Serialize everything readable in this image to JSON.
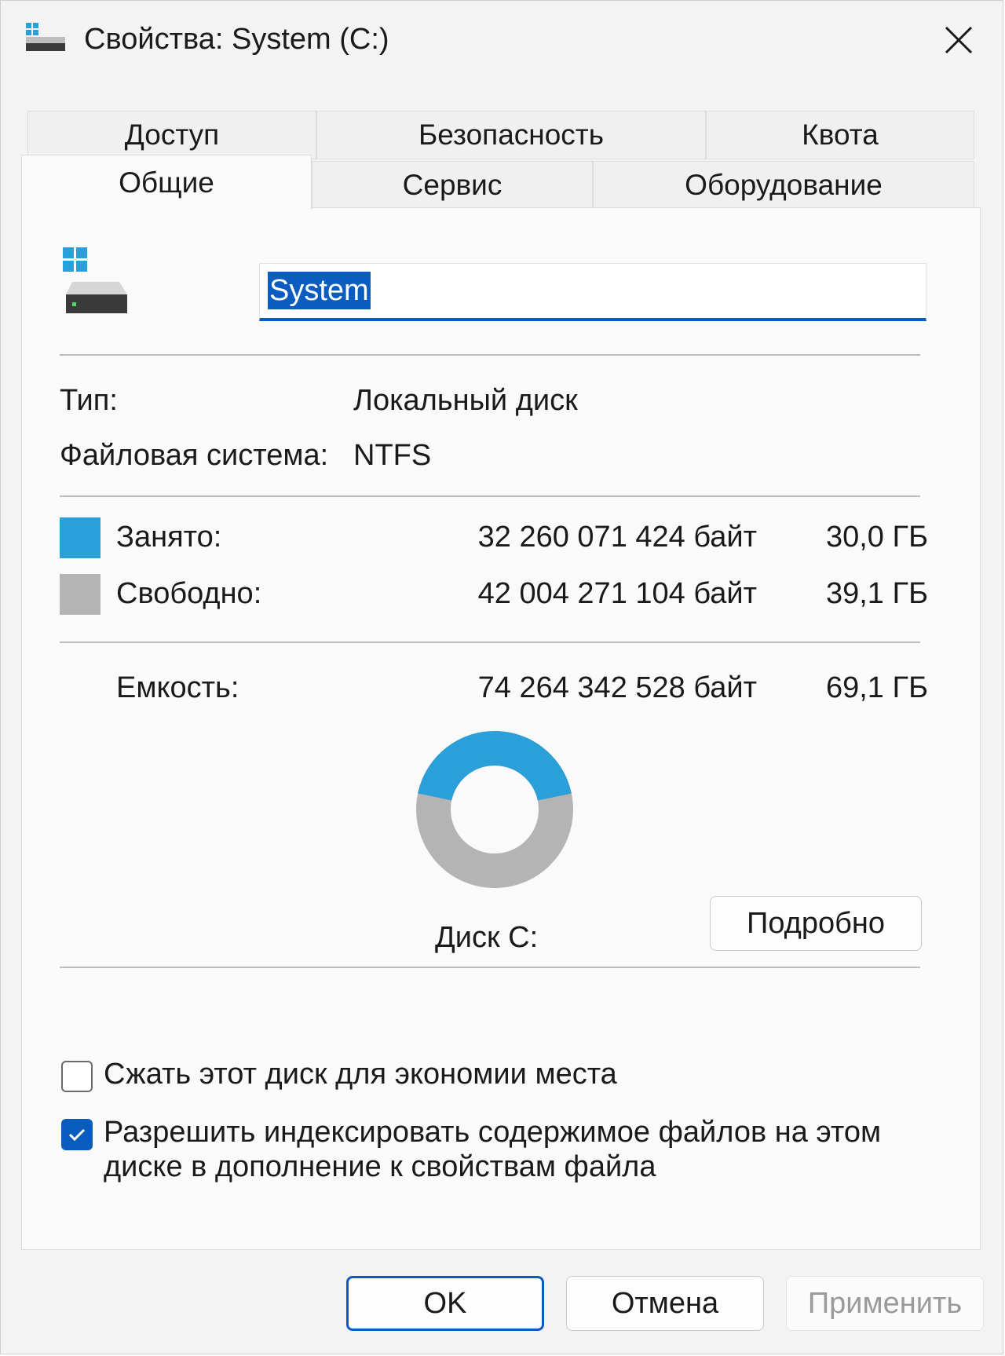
{
  "window": {
    "title": "Свойства: System (C:)"
  },
  "tabs": {
    "row1": [
      "Доступ",
      "Безопасность",
      "Квота"
    ],
    "row2": [
      "Общие",
      "Сервис",
      "Оборудование"
    ],
    "active": "Общие"
  },
  "general": {
    "name_value": "System",
    "type_label": "Тип:",
    "type_value": "Локальный диск",
    "fs_label": "Файловая система:",
    "fs_value": "NTFS",
    "used": {
      "label": "Занято:",
      "bytes": "32 260 071 424 байт",
      "size": "30,0 ГБ",
      "color": "#2a9fd8"
    },
    "free": {
      "label": "Свободно:",
      "bytes": "42 004 271 104 байт",
      "size": "39,1 ГБ",
      "color": "#b4b4b4"
    },
    "capacity": {
      "label": "Емкость:",
      "bytes": "74 264 342 528 байт",
      "size": "69,1 ГБ"
    },
    "used_fraction": 0.434,
    "disk_label": "Диск С:",
    "details_button": "Подробно",
    "compress": {
      "label": "Сжать этот диск для экономии места",
      "checked": false
    },
    "index": {
      "line1": "Разрешить индексировать содержимое файлов на этом",
      "line2": "диске в дополнение к свойствам файла",
      "checked": true
    }
  },
  "buttons": {
    "ok": "OK",
    "cancel": "Отмена",
    "apply": "Применить",
    "apply_enabled": false
  },
  "colors": {
    "accent": "#0b5cbf"
  }
}
